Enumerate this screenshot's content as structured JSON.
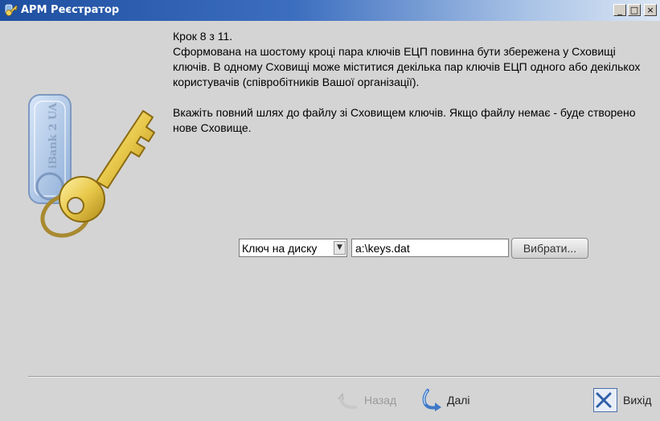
{
  "window": {
    "title": "АРМ Реєстратор",
    "minimize_label": "_",
    "maximize_label": "□",
    "close_label": "×"
  },
  "logo": {
    "tag_text": "iBank 2 UA"
  },
  "instructions": {
    "step": "Крок 8 з 11.",
    "paragraph1": "Сформована на шостому кроці пара ключів ЕЦП повинна бути збережена у Сховищі ключів. В одному Сховищі може міститися декілька пар ключів ЕЦП одного або декількох користувачів (співробітників Вашої організації).",
    "paragraph2": "Вкажіть повний шлях до файлу зі Сховищем ключів. Якщо файлу немає - буде створено нове Сховище."
  },
  "storage": {
    "type_selected": "Ключ на диску",
    "path_value": "a:\\keys.dat",
    "browse_label": "Вибрати..."
  },
  "navigation": {
    "back_label": "Назад",
    "next_label": "Далі",
    "exit_label": "Вихід"
  },
  "colors": {
    "titlebar_start": "#1e4fa0",
    "background": "#d4d4d4",
    "key_gold": "#e8c84a"
  }
}
